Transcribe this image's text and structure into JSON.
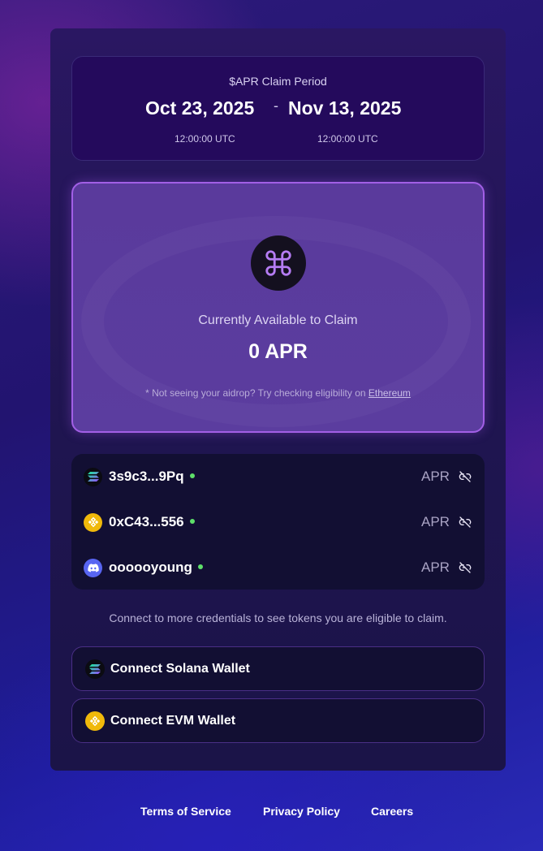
{
  "period": {
    "label": "$APR Claim Period",
    "start_date": "Oct 23, 2025",
    "separator": "-",
    "end_date": "Nov 13, 2025",
    "start_time": "12:00:00 UTC",
    "end_time": "12:00:00 UTC"
  },
  "claim": {
    "logo_icon": "command-icon",
    "available_label": "Currently Available to Claim",
    "amount": "0 APR",
    "note_prefix": "* Not seeing your aidrop? Try checking eligibility on ",
    "note_link": "Ethereum"
  },
  "credentials": [
    {
      "icon": "solana-icon",
      "name": "3s9c3...9Pq",
      "token": "APR",
      "status": "connected"
    },
    {
      "icon": "bnb-icon",
      "name": "0xC43...556",
      "token": "APR",
      "status": "connected"
    },
    {
      "icon": "discord-icon",
      "name": "oooooyoung",
      "token": "APR",
      "status": "connected"
    }
  ],
  "hint": "Connect to more credentials to see tokens you are eligible to claim.",
  "connect_buttons": [
    {
      "icon": "solana-icon",
      "label": "Connect Solana Wallet"
    },
    {
      "icon": "bnb-icon",
      "label": "Connect EVM Wallet"
    }
  ],
  "footer": {
    "terms": "Terms of Service",
    "privacy": "Privacy Policy",
    "careers": "Careers"
  },
  "colors": {
    "accent": "#a25fe6",
    "status_dot": "#5ee06a",
    "bnb": "#f0b90b",
    "discord": "#5865f2"
  }
}
